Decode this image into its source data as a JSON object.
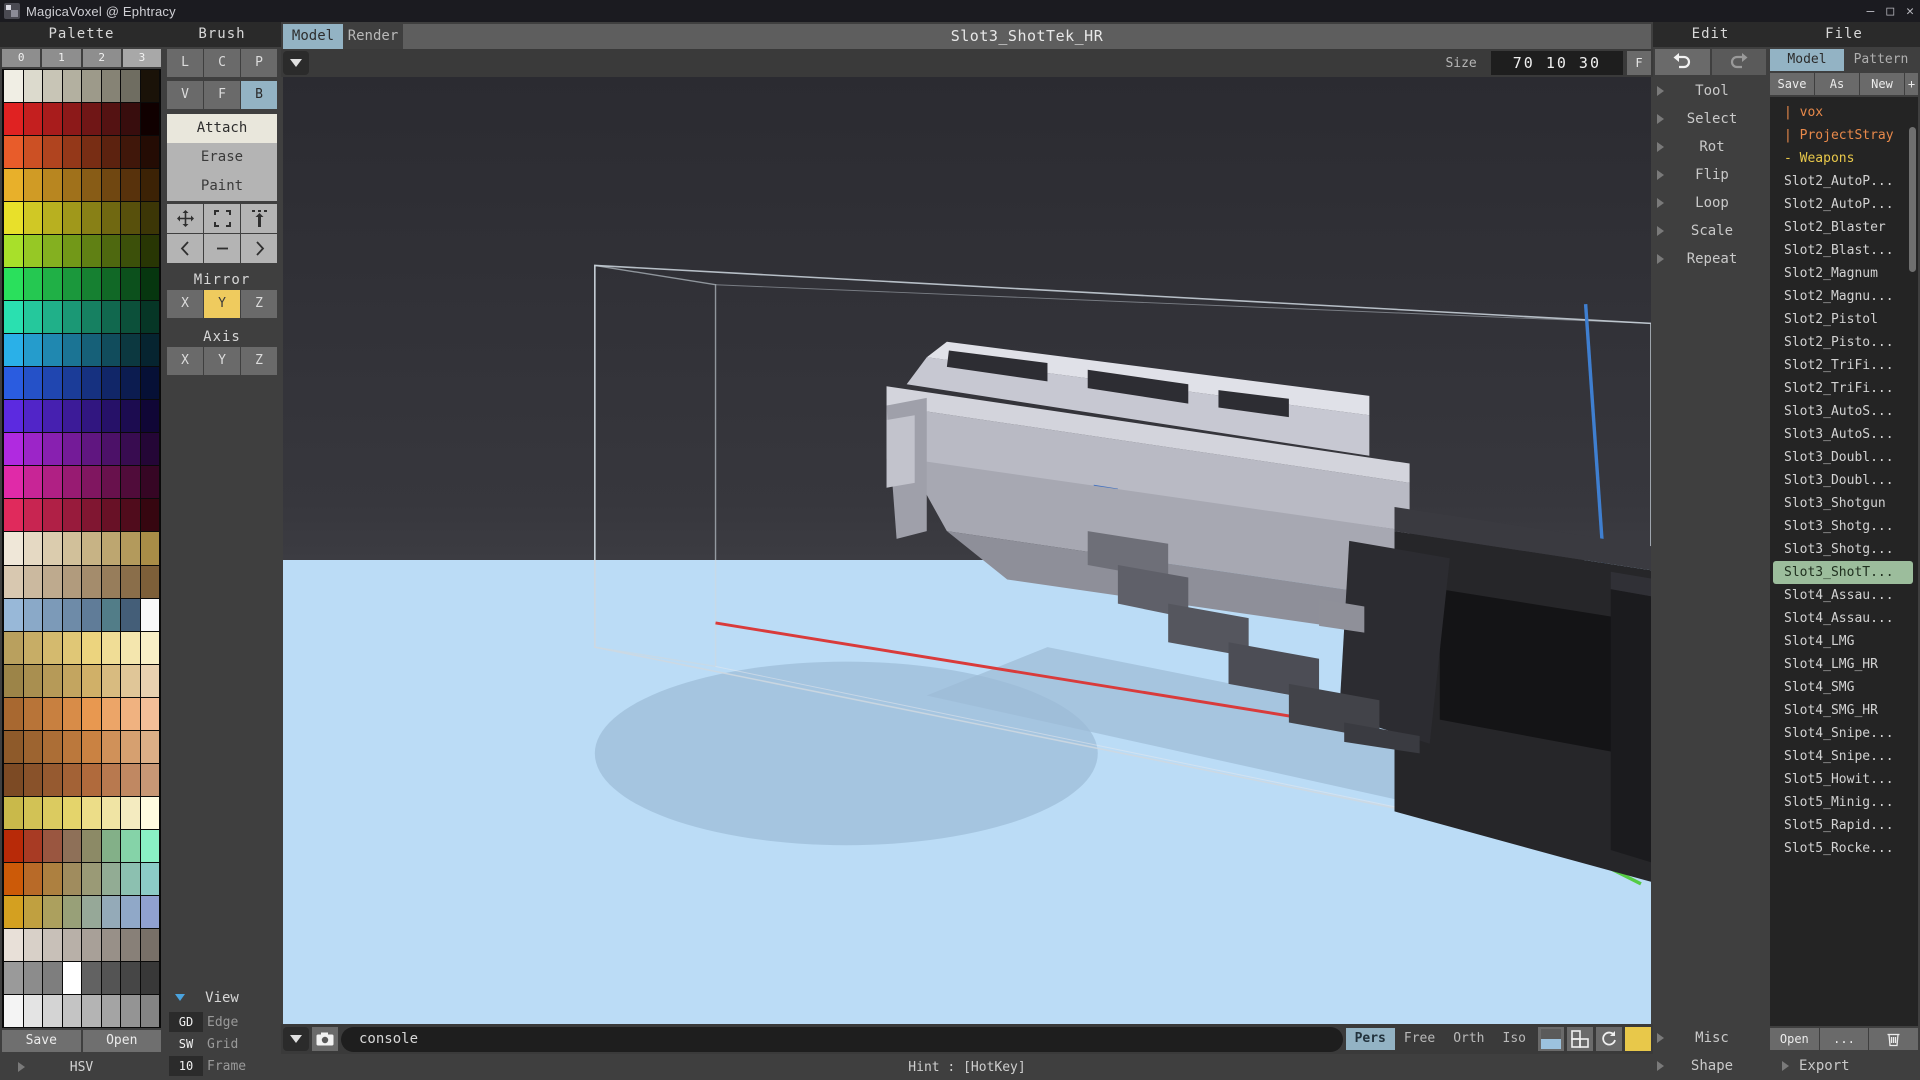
{
  "window": {
    "title": "MagicaVoxel @ Ephtracy",
    "buttons": [
      "–",
      "□",
      "✕"
    ]
  },
  "palette": {
    "header": "Palette",
    "tabs": [
      "0",
      "1",
      "2",
      "3"
    ],
    "selected_tab": "3",
    "save_label": "Save",
    "open_label": "Open",
    "hsv_label": "HSV",
    "colors": [
      "#f0eee4",
      "#dcdacd",
      "#c8c5b6",
      "#b3b0a0",
      "#9d9a8a",
      "#868375",
      "#6f6d61",
      "#1a1208",
      "#e02222",
      "#c41f1f",
      "#a81c1c",
      "#8c1919",
      "#701616",
      "#541212",
      "#380d0d",
      "#100000",
      "#e85c2a",
      "#cc5024",
      "#b0441f",
      "#943819",
      "#782d14",
      "#5c220f",
      "#40170a",
      "#240c04",
      "#e8b02a",
      "#d09b25",
      "#b88620",
      "#a0711b",
      "#885c16",
      "#704711",
      "#58320c",
      "#3c2205",
      "#e8e02a",
      "#d0c825",
      "#b8b020",
      "#a0981b",
      "#888016",
      "#706811",
      "#58500c",
      "#3c3606",
      "#a8e02a",
      "#96c825",
      "#84b020",
      "#729818",
      "#608014",
      "#4e680f",
      "#3c500a",
      "#283604",
      "#2ae05c",
      "#25c851",
      "#20b046",
      "#1b983c",
      "#168031",
      "#116826",
      "#0c501c",
      "#06360f",
      "#2ae0b0",
      "#25c89c",
      "#20b089",
      "#1b9875",
      "#168061",
      "#11684e",
      "#0c503a",
      "#063626",
      "#2ab0e8",
      "#259ccc",
      "#2088b0",
      "#1b7494",
      "#166078",
      "#114c5c",
      "#0c3840",
      "#062430",
      "#2a5ce0",
      "#2551c8",
      "#2046b0",
      "#1b3c98",
      "#163180",
      "#112668",
      "#0c1c50",
      "#061036",
      "#5c2ae0",
      "#5125c8",
      "#4620b0",
      "#3c1b98",
      "#311680",
      "#261168",
      "#1c0c50",
      "#100636",
      "#b02ae0",
      "#9c25c8",
      "#8820b0",
      "#741b98",
      "#601680",
      "#4c1168",
      "#380c50",
      "#240636",
      "#e02aa8",
      "#c82596",
      "#b02084",
      "#981b72",
      "#801660",
      "#68114c",
      "#500c3a",
      "#360624",
      "#e02a5c",
      "#c82551",
      "#b02046",
      "#981b3c",
      "#801631",
      "#681126",
      "#500c1c",
      "#360610",
      "#efe7d8",
      "#e5d9c3",
      "#dbccae",
      "#d1c09a",
      "#c7b385",
      "#bda670",
      "#b39a5c",
      "#a98d47",
      "#d8c8b0",
      "#cbb99f",
      "#beaa8e",
      "#b19b7d",
      "#a48c6c",
      "#977d5b",
      "#8a6e4a",
      "#7d5f39",
      "#98b8d8",
      "#8aa9c8",
      "#7c9ab8",
      "#6e8ba8",
      "#607c98",
      "#527d88",
      "#445e78",
      "#f8f8f8",
      "#b9a05e",
      "#c7ad66",
      "#d4ba6e",
      "#e0c776",
      "#ecd47e",
      "#f0dd96",
      "#f4e6ae",
      "#f8efc6",
      "#9c8448",
      "#a98f50",
      "#b69a58",
      "#c3a560",
      "#d0b068",
      "#d8bb80",
      "#e0c698",
      "#e8d1b0",
      "#a86830",
      "#b87438",
      "#c88040",
      "#d88c48",
      "#e89850",
      "#eca568",
      "#f0b280",
      "#f4bf98",
      "#8e5a2a",
      "#9d6430",
      "#ac6e36",
      "#bb783c",
      "#ca8242",
      "#d09159",
      "#d6a070",
      "#dcaf87",
      "#7c4a24",
      "#89522a",
      "#965a30",
      "#a36236",
      "#b06a3c",
      "#b8794f",
      "#c08862",
      "#c89775",
      "#c9b94a",
      "#d2c255",
      "#dbcb60",
      "#e4d46b",
      "#ecdd88",
      "#f0e4a4",
      "#f4ebc0",
      "#fffbe0",
      "#b82a08",
      "#a83b24",
      "#9a5640",
      "#8e7058",
      "#8c8a66",
      "#83b088",
      "#85d3a8",
      "#8af0c4",
      "#cc5a08",
      "#b86a28",
      "#ad8040",
      "#a08c5e",
      "#9a9a76",
      "#92ac94",
      "#8cc0b0",
      "#8ccbc6",
      "#d4a020",
      "#c0a040",
      "#aca05e",
      "#98a078",
      "#96a898",
      "#94aab8",
      "#90a8c8",
      "#90a0d0",
      "#e8e0d8",
      "#d8d0c8",
      "#c8c0b8",
      "#b8b0a8",
      "#a8a098",
      "#989088",
      "#888078",
      "#787068",
      "#9a9a9a",
      "#8c8c8c",
      "#7e7e7e",
      "#ffffff",
      "#626262",
      "#545454",
      "#464646",
      "#383838",
      "#f4f4f4",
      "#e4e4e4",
      "#d4d4d4",
      "#c4c4c4",
      "#b4b4b4",
      "#a4a4a4",
      "#949494",
      "#848484"
    ],
    "current_swatch_index": 219
  },
  "brush": {
    "header": "Brush",
    "shape_row1": [
      "L",
      "C",
      "P"
    ],
    "shape_row2": [
      "V",
      "F",
      "B"
    ],
    "selected_shape": "B",
    "modes": [
      "Attach",
      "Erase",
      "Paint"
    ],
    "selected_mode": "Attach",
    "icons_row1": [
      "move-icon",
      "box-select-icon",
      "extrude-icon"
    ],
    "icons_row2": [
      "prev-icon",
      "minus-icon",
      "next-icon"
    ],
    "mirror_label": "Mirror",
    "mirror_axes": [
      "X",
      "Y",
      "Z"
    ],
    "mirror_active": "Y",
    "axis_label": "Axis",
    "axis_axes": [
      "X",
      "Y",
      "Z"
    ],
    "view": {
      "label": "View",
      "rows": [
        {
          "key": "GD",
          "value": "Edge",
          "boxed": true
        },
        {
          "key": "SW",
          "value": "Grid",
          "boxed": false
        },
        {
          "key": "10",
          "value": "Frame",
          "boxed": true
        }
      ]
    }
  },
  "center": {
    "tabs": [
      "Model",
      "Render"
    ],
    "selected_tab": "Model",
    "model_title": "Slot3_ShotTek_HR",
    "size_label": "Size",
    "size_value": "70 10 30",
    "frame_button": "F",
    "console_placeholder": "console",
    "camera_modes": [
      "Pers",
      "Free",
      "Orth",
      "Iso"
    ],
    "selected_camera": "Pers",
    "bottom_icons": [
      "shade-icon",
      "grid-box-icon",
      "rotate-icon"
    ],
    "accent_swatch": "#e8c84a",
    "hint": "Hint : [HotKey]"
  },
  "edit": {
    "header": "Edit",
    "undo_icon": "undo-icon",
    "redo_icon": "redo-icon",
    "items": [
      "Tool",
      "Select",
      "Rot",
      "Flip",
      "Loop",
      "Scale",
      "Repeat"
    ],
    "bottom_items": [
      "Misc",
      "Shape"
    ]
  },
  "file": {
    "header": "File",
    "tabs": [
      "Model",
      "Pattern"
    ],
    "selected_tab": "Model",
    "actions": [
      "Save",
      "As",
      "New"
    ],
    "plus_label": "+",
    "items": [
      {
        "label": "vox",
        "kind": "path",
        "prefix": "|"
      },
      {
        "label": "ProjectStray",
        "kind": "path",
        "prefix": "|"
      },
      {
        "label": "Weapons",
        "kind": "folder",
        "prefix": "-"
      },
      {
        "label": "Slot2_AutoP...",
        "kind": "file"
      },
      {
        "label": "Slot2_AutoP...",
        "kind": "file"
      },
      {
        "label": "Slot2_Blaster",
        "kind": "file"
      },
      {
        "label": "Slot2_Blast...",
        "kind": "file"
      },
      {
        "label": "Slot2_Magnum",
        "kind": "file"
      },
      {
        "label": "Slot2_Magnu...",
        "kind": "file"
      },
      {
        "label": "Slot2_Pistol",
        "kind": "file"
      },
      {
        "label": "Slot2_Pisto...",
        "kind": "file"
      },
      {
        "label": "Slot2_TriFi...",
        "kind": "file"
      },
      {
        "label": "Slot2_TriFi...",
        "kind": "file"
      },
      {
        "label": "Slot3_AutoS...",
        "kind": "file"
      },
      {
        "label": "Slot3_AutoS...",
        "kind": "file"
      },
      {
        "label": "Slot3_Doubl...",
        "kind": "file"
      },
      {
        "label": "Slot3_Doubl...",
        "kind": "file"
      },
      {
        "label": "Slot3_Shotgun",
        "kind": "file"
      },
      {
        "label": "Slot3_Shotg...",
        "kind": "file"
      },
      {
        "label": "Slot3_Shotg...",
        "kind": "file"
      },
      {
        "label": "Slot3_ShotT...",
        "kind": "file",
        "selected": true
      },
      {
        "label": "Slot4_Assau...",
        "kind": "file"
      },
      {
        "label": "Slot4_Assau...",
        "kind": "file"
      },
      {
        "label": "Slot4_LMG",
        "kind": "file"
      },
      {
        "label": "Slot4_LMG_HR",
        "kind": "file"
      },
      {
        "label": "Slot4_SMG",
        "kind": "file"
      },
      {
        "label": "Slot4_SMG_HR",
        "kind": "file"
      },
      {
        "label": "Slot4_Snipe...",
        "kind": "file"
      },
      {
        "label": "Slot4_Snipe...",
        "kind": "file"
      },
      {
        "label": "Slot5_Howit...",
        "kind": "file"
      },
      {
        "label": "Slot5_Minig...",
        "kind": "file"
      },
      {
        "label": "Slot5_Rapid...",
        "kind": "file"
      },
      {
        "label": "Slot5_Rocke...",
        "kind": "file"
      }
    ],
    "open_label": "Open",
    "more_label": "...",
    "delete_icon": "trash-icon",
    "export_label": "Export"
  }
}
